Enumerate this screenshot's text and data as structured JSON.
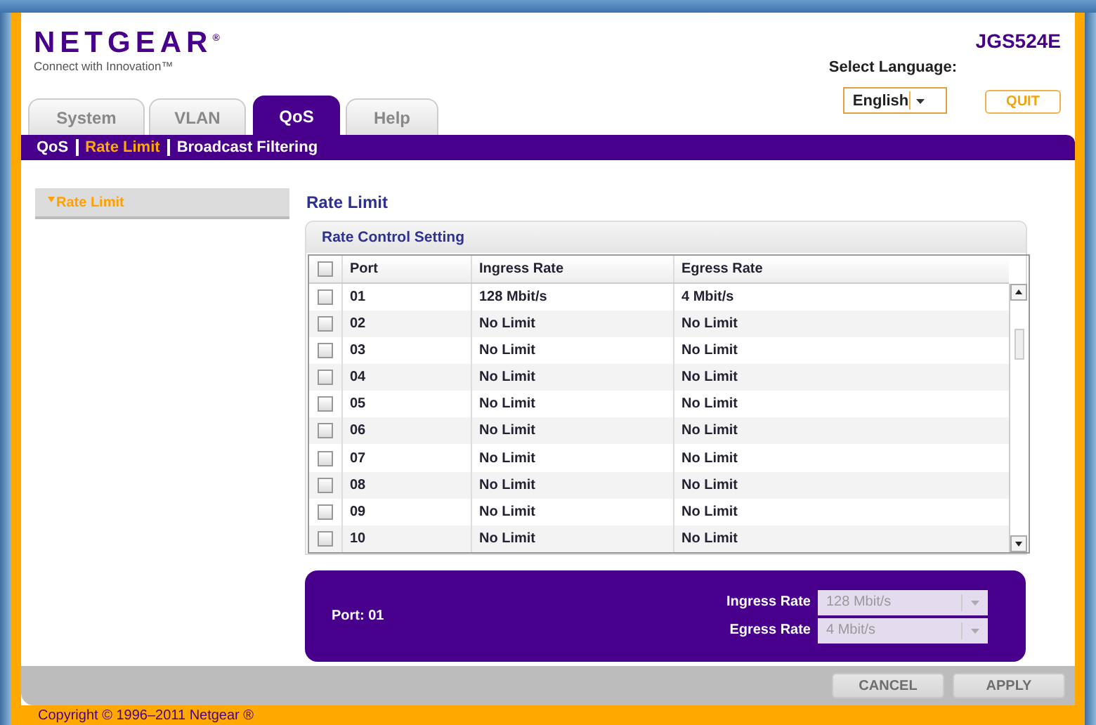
{
  "logo": {
    "name": "NETGEAR$^{®}$",
    "tagline": "Connect with Innovation™"
  },
  "model": "JGS524E",
  "language": {
    "label": "Select Language:",
    "value": "English"
  },
  "quit_button": "QUIT",
  "tabs": [
    {
      "label": "System",
      "selected": false
    },
    {
      "label": "VLAN",
      "selected": false
    },
    {
      "label": "QoS",
      "selected": true
    },
    {
      "label": "Help",
      "selected": false
    }
  ],
  "subnav": [
    {
      "label": "QoS",
      "selected": false
    },
    {
      "label": "Rate Limit",
      "selected": true
    },
    {
      "label": "Broadcast Filtering",
      "selected": false
    }
  ],
  "sidebar": {
    "items": [
      {
        "label": "Rate Limit",
        "selected": true
      }
    ]
  },
  "page_title": "Rate Limit",
  "table": {
    "title": "Rate Control Setting",
    "select_all_checked": false,
    "columns": [
      "Port",
      "Ingress Rate",
      "Egress Rate"
    ],
    "rows": [
      {
        "checked": false,
        "cells": [
          "01",
          "128 Mbit/s",
          "4 Mbit/s"
        ]
      },
      {
        "checked": false,
        "cells": [
          "02",
          "No Limit",
          "No Limit"
        ]
      },
      {
        "checked": false,
        "cells": [
          "03",
          "No Limit",
          "No Limit"
        ]
      },
      {
        "checked": false,
        "cells": [
          "04",
          "No Limit",
          "No Limit"
        ]
      },
      {
        "checked": false,
        "cells": [
          "05",
          "No Limit",
          "No Limit"
        ]
      },
      {
        "checked": false,
        "cells": [
          "06",
          "No Limit",
          "No Limit"
        ]
      },
      {
        "checked": false,
        "cells": [
          "07",
          "No Limit",
          "No Limit"
        ]
      },
      {
        "checked": false,
        "cells": [
          "08",
          "No Limit",
          "No Limit"
        ]
      },
      {
        "checked": false,
        "cells": [
          "09",
          "No Limit",
          "No Limit"
        ]
      },
      {
        "checked": false,
        "cells": [
          "10",
          "No Limit",
          "No Limit"
        ]
      }
    ]
  },
  "port_panel": {
    "port_label": "Port: 01",
    "fields": [
      {
        "label": "Ingress Rate",
        "value": "128 Mbit/s",
        "disabled": true
      },
      {
        "label": "Egress Rate",
        "value": "4 Mbit/s",
        "disabled": true
      }
    ]
  },
  "buttons": [
    {
      "label": "CANCEL",
      "disabled": true
    },
    {
      "label": "APPLY",
      "disabled": true
    }
  ],
  "copyright": "Copyright © 1996–2011 Netgear ®"
}
